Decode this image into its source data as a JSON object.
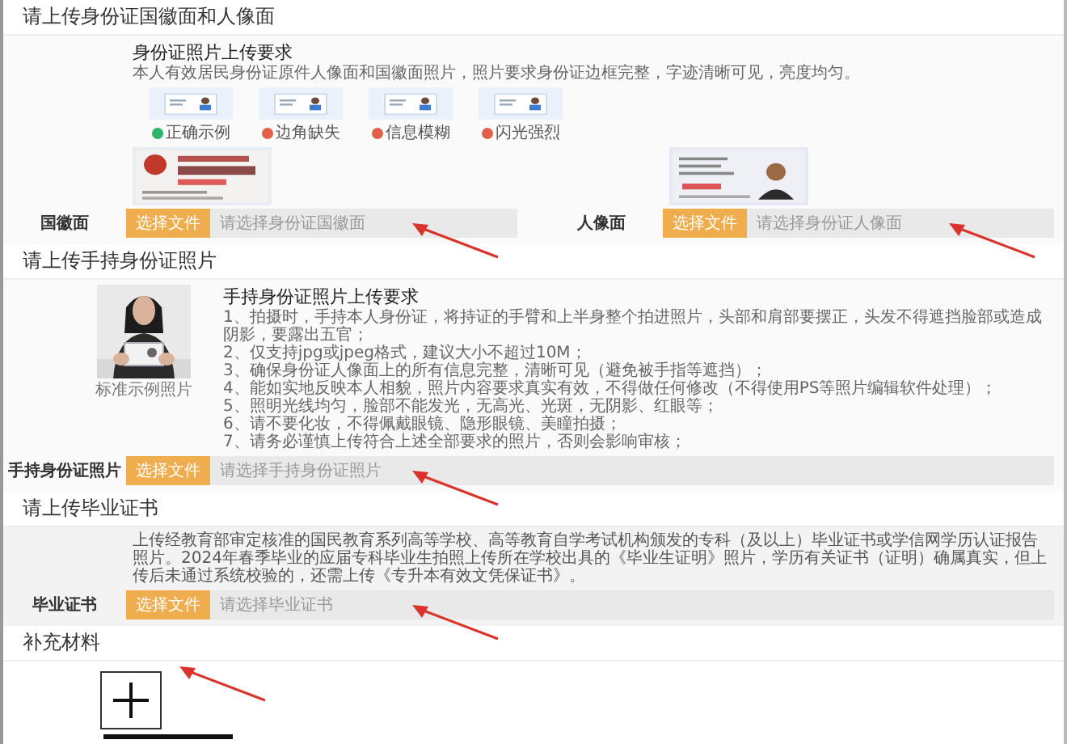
{
  "sections": [
    {
      "kind": "id_card",
      "title": "请上传身份证国徽面和人像面",
      "requirements": {
        "title": "身份证照片上传要求",
        "text": "本人有效居民身份证原件人像面和国徽面照片，照片要求身份证边框完整，字迹清晰可见，亮度均匀。"
      },
      "examples": [
        {
          "label": "正确示例",
          "color": "#2db36a"
        },
        {
          "label": "边角缺失",
          "color": "#e0604a"
        },
        {
          "label": "信息模糊",
          "color": "#e0604a"
        },
        {
          "label": "闪光强烈",
          "color": "#e0604a"
        }
      ],
      "uploads": [
        {
          "label": "国徽面",
          "button": "选择文件",
          "placeholder": "请选择身份证国徽面",
          "picture": true,
          "marked": true
        },
        {
          "label": "人像面",
          "button": "选择文件",
          "placeholder": "请选择身份证人像面",
          "picture": true,
          "marked": true
        }
      ]
    },
    {
      "kind": "handheld",
      "title": "请上传手持身份证照片",
      "sample": {
        "kind": "picture",
        "caption": "标准示例照片"
      },
      "requirements": {
        "title": "手持身份证照片上传要求",
        "items": [
          "1、拍摄时，手持本人身份证，将持证的手臂和上半身整个拍进照片，头部和肩部要摆正，头发不得遮挡脸部或造成阴影，要露出五官；",
          "2、仅支持jpg或jpeg格式，建议大小不超过10M；",
          "3、确保身份证人像面上的所有信息完整，清晰可见（避免被手指等遮挡）；",
          "4、能如实地反映本人相貌，照片内容要求真实有效，不得做任何修改（不得使用PS等照片编辑软件处理）；",
          "5、照明光线均匀，脸部不能发光，无高光、光斑，无阴影、红眼等；",
          "6、请不要化妆，不得佩戴眼镜、隐形眼镜、美瞳拍摄；",
          "7、请务必谨慎上传符合上述全部要求的照片，否则会影响审核；"
        ]
      },
      "uploads": [
        {
          "label": "手持身份证照片",
          "button": "选择文件",
          "placeholder": "请选择手持身份证照片",
          "picture": false,
          "marked": true
        }
      ]
    },
    {
      "kind": "certificate",
      "title": "请上传毕业证书",
      "text": "上传经教育部审定核准的国民教育系列高等学校、高等教育自学考试机构颁发的专科（及以上）毕业证书或学信网学历认证报告照片。2024年春季毕业的应届专科毕业生拍照上传所在学校出具的《毕业生证明》照片，学历有关证书（证明）确属真实，但上传后未通过系统校验的，还需上传《专升本有效文凭保证书》。",
      "uploads": [
        {
          "label": "毕业证书",
          "button": "选择文件",
          "placeholder": "请选择毕业证书",
          "picture": false,
          "marked": true
        }
      ]
    },
    {
      "kind": "supplement",
      "title": "补充材料",
      "add_button": true,
      "marked": true
    }
  ]
}
